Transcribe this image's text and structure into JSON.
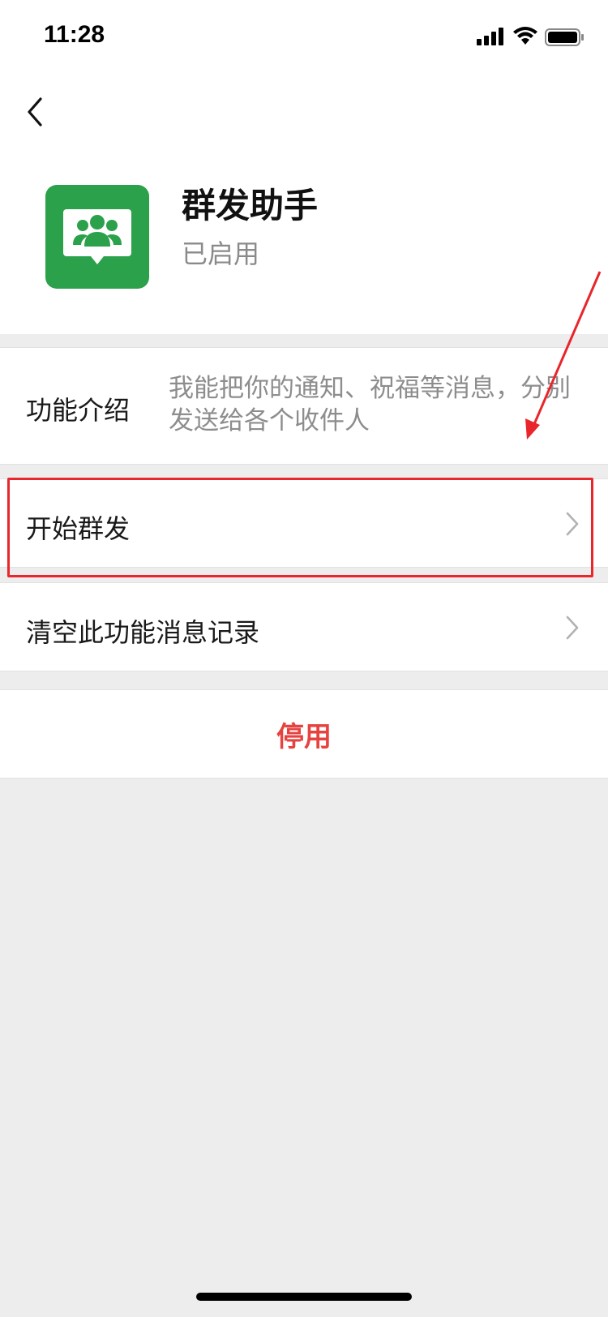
{
  "status_bar": {
    "time": "11:28",
    "icons": [
      "signal-icon",
      "wifi-icon",
      "battery-icon"
    ]
  },
  "nav": {
    "back_icon": "back-icon"
  },
  "profile": {
    "name": "群发助手",
    "status": "已启用",
    "icon_name": "group-users-icon",
    "icon_color": "#2aa14a"
  },
  "intro": {
    "label": "功能介绍",
    "description": "我能把你的通知、祝福等消息，分别发送给各个收件人"
  },
  "menu": {
    "start": "开始群发",
    "clear": "清空此功能消息记录"
  },
  "disable": {
    "label": "停用",
    "color": "#e64340"
  },
  "annotation": {
    "highlight_color": "#e8262b"
  }
}
